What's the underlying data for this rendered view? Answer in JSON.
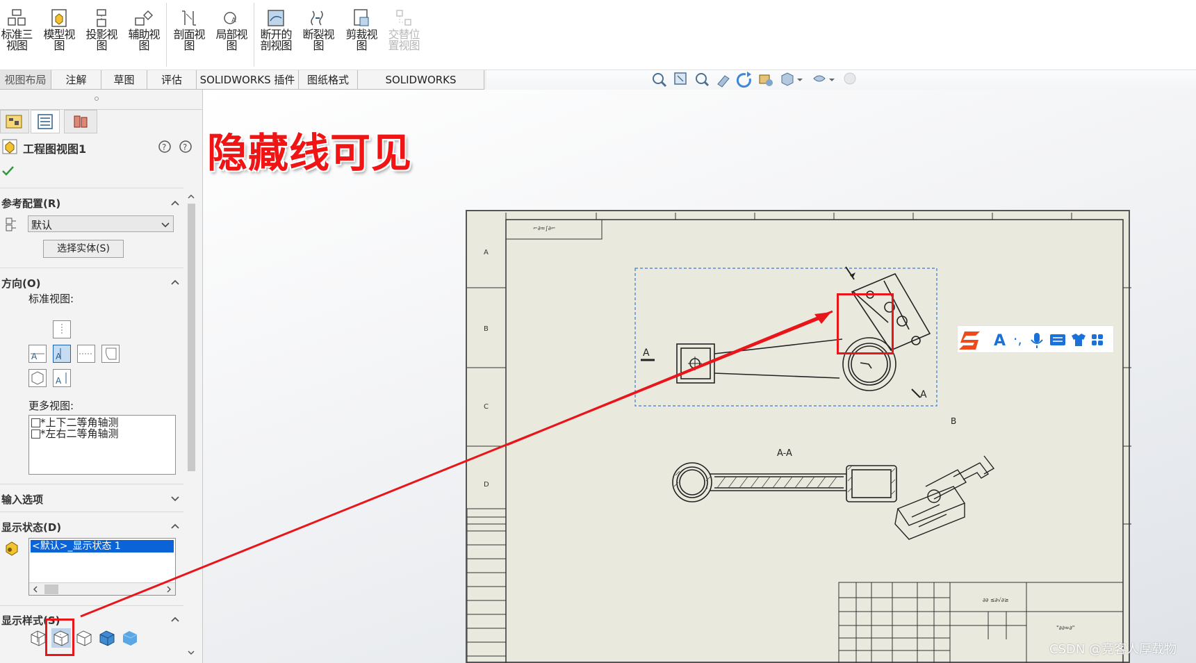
{
  "ribbon": {
    "buttons": [
      {
        "label_l1": "标准三",
        "label_l2": "视图",
        "icon": "standard-3view-icon"
      },
      {
        "label_l1": "模型视",
        "label_l2": "图",
        "icon": "model-view-icon"
      },
      {
        "label_l1": "投影视",
        "label_l2": "图",
        "icon": "projected-view-icon"
      },
      {
        "label_l1": "辅助视",
        "label_l2": "图",
        "icon": "auxiliary-view-icon"
      },
      {
        "label_l1": "剖面视",
        "label_l2": "图",
        "icon": "section-view-icon"
      },
      {
        "label_l1": "局部视",
        "label_l2": "图",
        "icon": "detail-view-icon"
      },
      {
        "label_l1": "断开的",
        "label_l2": "剖视图",
        "icon": "broken-out-section-icon"
      },
      {
        "label_l1": "断裂视",
        "label_l2": "图",
        "icon": "break-view-icon"
      },
      {
        "label_l1": "剪裁视",
        "label_l2": "图",
        "icon": "crop-view-icon"
      },
      {
        "label_l1": "交替位",
        "label_l2": "置视图",
        "icon": "alternate-position-icon",
        "disabled": true
      }
    ]
  },
  "tabs": [
    "视图布局",
    "注解",
    "草图",
    "评估",
    "SOLIDWORKS 插件",
    "图纸格式",
    "SOLIDWORKS Inspection"
  ],
  "panel": {
    "title": "工程图视图1",
    "reference_config": {
      "header": "参考配置(R)",
      "selected": "默认",
      "select_bodies_button": "选择实体(S)"
    },
    "orientation": {
      "header": "方向(O)",
      "standard_views_label": "标准视图:",
      "more_views_label": "更多视图:",
      "more_views": [
        "*上下二等角轴测",
        "*左右二等角轴测"
      ]
    },
    "import_options": {
      "header": "输入选项"
    },
    "display_state": {
      "header": "显示状态(D)",
      "selected_item": "<默认>_显示状态 1"
    },
    "display_style": {
      "header": "显示样式(S)"
    }
  },
  "annotation": {
    "text": "隐藏线可见",
    "color": "#f01414"
  },
  "drawing": {
    "view_label_top_left": "A",
    "view_label_bottom_right": "A",
    "section_label": "A-A",
    "view_b_label": "B",
    "zone_letters_left": [
      "A",
      "B",
      "C",
      "D"
    ]
  },
  "watermark": "CSDN @竞客人厚载物",
  "colors": {
    "highlight_red": "#e8151b",
    "selection_blue": "#0a64d8",
    "sheet": "#eae9de"
  }
}
